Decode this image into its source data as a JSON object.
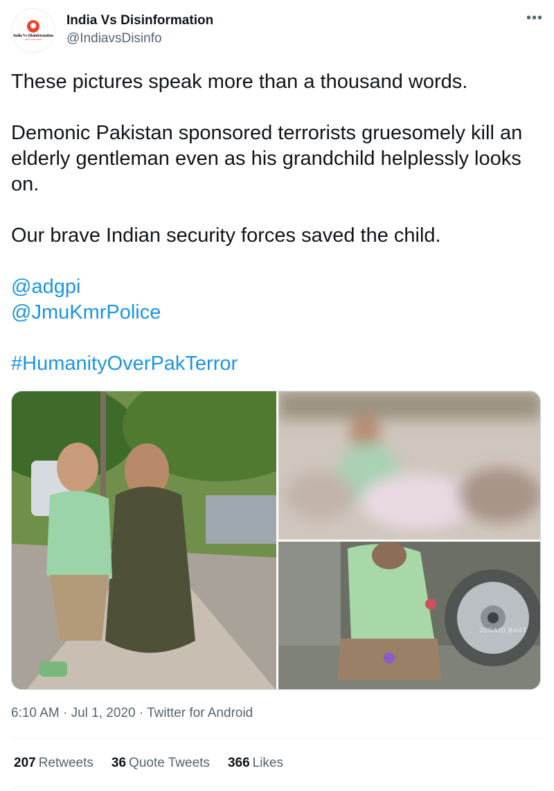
{
  "author": {
    "display_name": "India Vs Disinformation",
    "handle": "@IndiavsDisinfo",
    "avatar_logo_text": "India Vs Disinformation",
    "avatar_logo_sub": "TRUTH MATTERS"
  },
  "menu_icon": "more-horizontal-icon",
  "tweet": {
    "p1": "These pictures speak more than a thousand words.",
    "p2": "Demonic Pakistan sponsored terrorists gruesomely kill an elderly gentleman even as his grandchild helplessly looks on.",
    "p3": "Our brave Indian security forces saved the child.",
    "mention1": "@adgpi",
    "mention2": "@JmuKmrPolice",
    "hashtag": "#HumanityOverPakTerror"
  },
  "media": {
    "image_watermark": "JUNAID BHAT"
  },
  "meta": {
    "time": "6:10 AM",
    "date": "Jul 1, 2020",
    "source": "Twitter for Android",
    "separator": "·"
  },
  "stats": {
    "retweets_count": "207",
    "retweets_label": "Retweets",
    "quotes_count": "36",
    "quotes_label": "Quote Tweets",
    "likes_count": "366",
    "likes_label": "Likes"
  },
  "colors": {
    "link": "#1b95e0",
    "secondary_text": "#536471",
    "primary_text": "#0f1419"
  }
}
